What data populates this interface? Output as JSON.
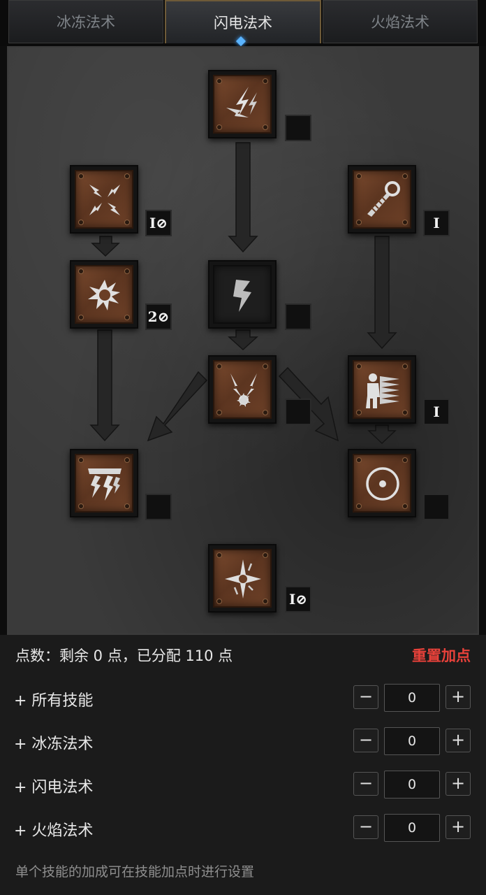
{
  "tabs": [
    {
      "label": "冰冻法术",
      "active": false
    },
    {
      "label": "闪电法术",
      "active": true
    },
    {
      "label": "火焰法术",
      "active": false
    }
  ],
  "tree": {
    "nodes": [
      {
        "id": "charged-bolt",
        "level": "",
        "active": true
      },
      {
        "id": "static-field",
        "level": "I⊘",
        "active": true
      },
      {
        "id": "telekinesis",
        "level": "I",
        "active": true
      },
      {
        "id": "nova",
        "level": "2⊘",
        "active": true
      },
      {
        "id": "lightning",
        "level": "",
        "active": false
      },
      {
        "id": "chain-lightning",
        "level": "",
        "active": true
      },
      {
        "id": "teleport",
        "level": "I",
        "active": true
      },
      {
        "id": "thunder-storm",
        "level": "",
        "active": true
      },
      {
        "id": "energy-shield",
        "level": "",
        "active": true
      },
      {
        "id": "lightning-mastery",
        "level": "I⊘",
        "active": true
      }
    ]
  },
  "points": {
    "summary": "点数：剩余 0 点，已分配 110 点",
    "reset_label": "重置加点"
  },
  "bonuses": [
    {
      "label": "+ 所有技能",
      "value": "0"
    },
    {
      "label": "+ 冰冻法术",
      "value": "0"
    },
    {
      "label": "+ 闪电法术",
      "value": "0"
    },
    {
      "label": "+ 火焰法术",
      "value": "0"
    }
  ],
  "buttons": {
    "minus": "−",
    "plus": "+"
  },
  "note": "单个技能的加成可在技能加点时进行设置",
  "colors": {
    "reset": "#e8413a",
    "active_tab_border": "#6e5a38",
    "skill_face": "#6a3e25"
  }
}
